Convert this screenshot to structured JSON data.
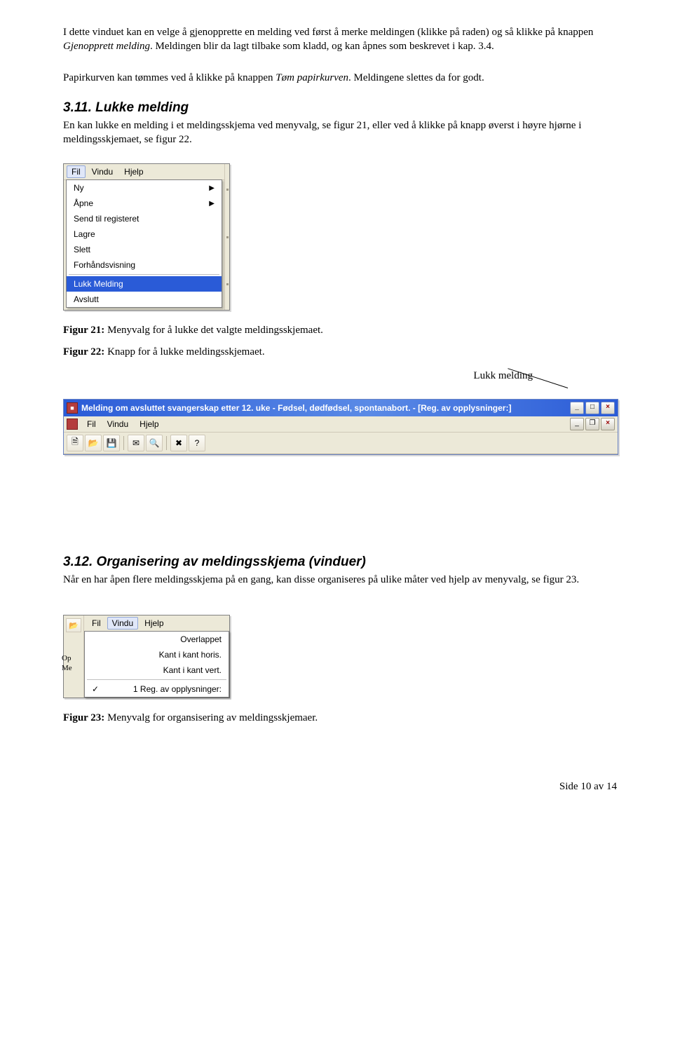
{
  "intro": {
    "p1a": "I dette vinduet kan en velge å gjenopprette en melding ved først å merke meldingen (klikke på raden) og så klikke på knappen ",
    "p1b": "Gjenopprett melding",
    "p1c": ". Meldingen blir da lagt tilbake som kladd, og kan åpnes som beskrevet i kap. 3.4.",
    "p2a": "Papirkurven kan tømmes ved å klikke på knappen ",
    "p2b": "Tøm papirkurven",
    "p2c": ". Meldingene slettes da for godt."
  },
  "sec311": {
    "heading": "3.11. Lukke melding",
    "body": "En kan lukke en melding i et meldingsskjema ved menyvalg, se figur 21, eller ved å klikke på knapp øverst i høyre hjørne i meldingsskjemaet, se figur 22."
  },
  "fig21": {
    "menubar": {
      "fil": "Fil",
      "vindu": "Vindu",
      "hjelp": "Hjelp"
    },
    "items": {
      "ny": "Ny",
      "apne": "Åpne",
      "send": "Send til registeret",
      "lagre": "Lagre",
      "slett": "Slett",
      "forhands": "Forhåndsvisning",
      "lukk": "Lukk Melding",
      "avslutt": "Avslutt"
    },
    "caption_b": "Figur 21:",
    "caption_t": " Menyvalg for å lukke det valgte meldingsskjemaet."
  },
  "fig22": {
    "caption_b": "Figur 22:",
    "caption_t": " Knapp for å lukke meldingsskjemaet.",
    "callout": "Lukk melding",
    "title": "Melding om avsluttet svangerskap etter 12. uke - Fødsel, dødfødsel, spontanabort. - [Reg. av opplysninger:]",
    "menubar": {
      "fil": "Fil",
      "vindu": "Vindu",
      "hjelp": "Hjelp"
    }
  },
  "sec312": {
    "heading": "3.12. Organisering av meldingsskjema (vinduer)",
    "body": "Når en har åpen flere meldingsskjema på en gang, kan disse organiseres på ulike måter ved hjelp av menyvalg, se figur 23."
  },
  "fig23": {
    "menubar": {
      "fil": "Fil",
      "vindu": "Vindu",
      "hjelp": "Hjelp"
    },
    "items": {
      "overlappet": "Overlappet",
      "horis": "Kant i kant horis.",
      "vert": "Kant i kant vert.",
      "reg": "1 Reg. av opplysninger:"
    },
    "side": {
      "op": "Op",
      "me": "Me"
    },
    "caption_b": "Figur 23:",
    "caption_t": " Menyvalg for organsisering av meldingsskjemaer."
  },
  "footer": "Side 10 av 14"
}
